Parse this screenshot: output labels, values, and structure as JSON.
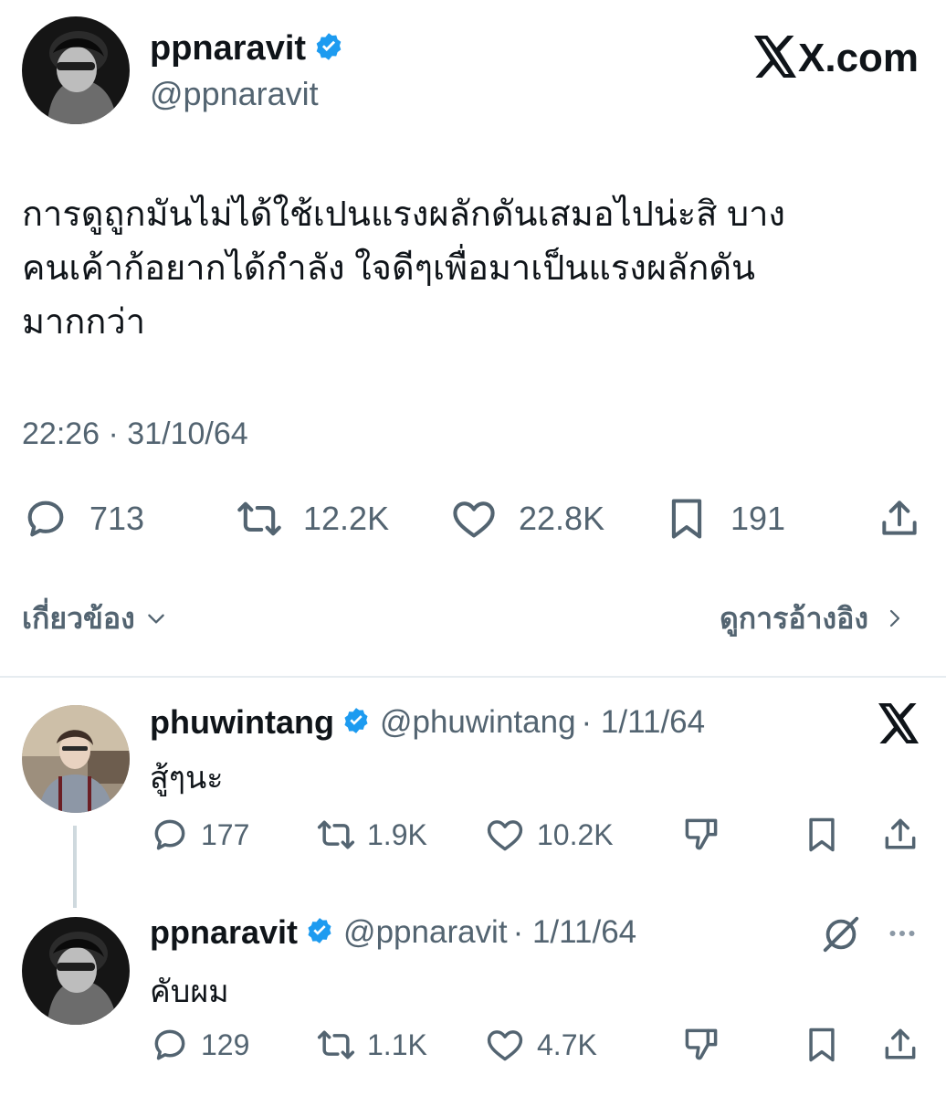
{
  "main_tweet": {
    "display_name": "ppnaravit",
    "handle": "@ppnaravit",
    "site_badge": "X.com",
    "text_lines": [
      "การดูถูกมันไม่ได้ใช้เปนแรงผลักดันเสมอไปน่ะสิ บาง",
      "คนเค้าก้อยากได้กำลัง ใจดีๆเพื่อมาเป็นแรงผลักดัน",
      "มากกว่า"
    ],
    "timestamp": "22:26 · 31/10/64",
    "stats": {
      "replies": "713",
      "retweets": "12.2K",
      "likes": "22.8K",
      "bookmarks": "191"
    },
    "related_label": "เกี่ยวข้อง",
    "quotes_label": "ดูการอ้างอิง"
  },
  "replies": [
    {
      "display_name": "phuwintang",
      "handle": "@phuwintang",
      "date": "· 1/11/64",
      "text": "สู้ๆนะ",
      "stats": {
        "replies": "177",
        "retweets": "1.9K",
        "likes": "10.2K"
      }
    },
    {
      "display_name": "ppnaravit",
      "handle": "@ppnaravit",
      "date": "· 1/11/64",
      "text": "คับผม",
      "stats": {
        "replies": "129",
        "retweets": "1.1K",
        "likes": "4.7K"
      }
    }
  ],
  "colors": {
    "verified": "#1d9bf0",
    "text": "#0f1419",
    "secondary": "#536471",
    "divider": "#e6ecf0"
  }
}
